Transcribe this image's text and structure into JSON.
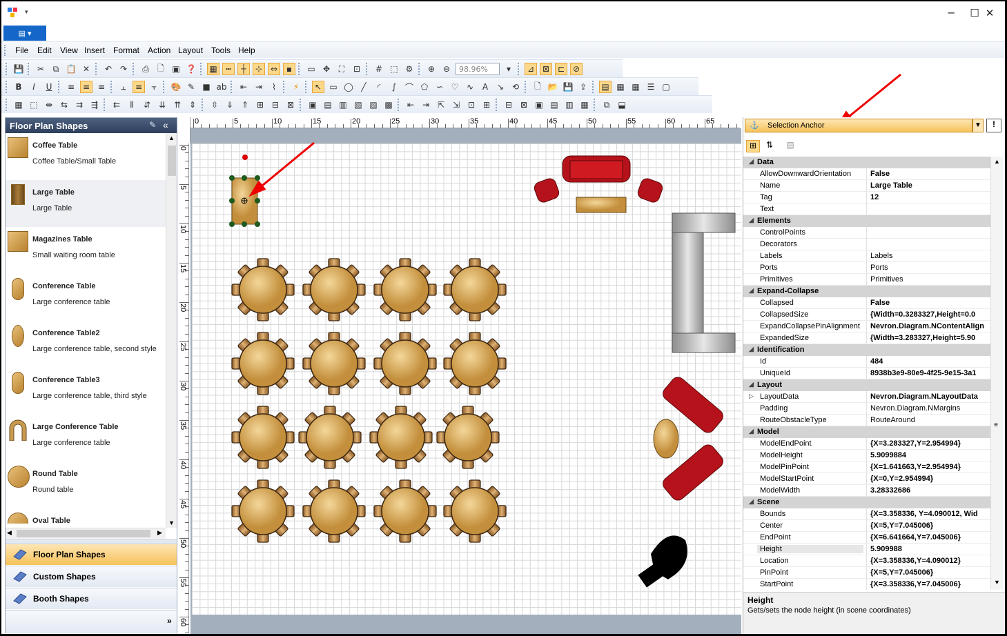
{
  "window": {
    "minimize": "─",
    "maximize": "☐",
    "close": "✕"
  },
  "app_menu": {
    "label": "▤ ▾"
  },
  "menubar": {
    "items": [
      "File",
      "Edit",
      "View",
      "Insert",
      "Format",
      "Action",
      "Layout",
      "Tools",
      "Help"
    ]
  },
  "toolbar": {
    "zoom": "98.96%"
  },
  "left_panel": {
    "title": "Floor Plan Shapes",
    "shapes": [
      {
        "name": "Coffee Table",
        "desc": "Coffee Table/Small Table"
      },
      {
        "name": "Large Table",
        "desc": "Large Table"
      },
      {
        "name": "Magazines Table",
        "desc": "Small waiting room table"
      },
      {
        "name": "Conference Table",
        "desc": "Large conference table"
      },
      {
        "name": "Conference Table2",
        "desc": "Large conference table, second style"
      },
      {
        "name": "Conference Table3",
        "desc": "Large conference table, third style"
      },
      {
        "name": "Large Conference Table",
        "desc": "Large conference table"
      },
      {
        "name": "Round Table",
        "desc": "Round table"
      },
      {
        "name": "Oval Table",
        "desc": ""
      }
    ],
    "nav": [
      "Floor Plan Shapes",
      "Custom Shapes",
      "Booth Shapes"
    ]
  },
  "ruler": {
    "h": [
      "0",
      "5",
      "10",
      "15",
      "20",
      "25",
      "30",
      "35",
      "40",
      "45",
      "50",
      "55",
      "60",
      "65"
    ],
    "v": [
      "0",
      "5",
      "10",
      "15",
      "20",
      "25",
      "30",
      "35",
      "40",
      "45",
      "50",
      "55",
      "60"
    ]
  },
  "property_grid": {
    "header": "Selection Anchor",
    "rows": [
      {
        "t": "cat",
        "n": "Data"
      },
      {
        "n": "AllowDownwardOrientation",
        "v": "False",
        "b": true
      },
      {
        "n": "Name",
        "v": "Large Table",
        "b": true
      },
      {
        "n": "Tag",
        "v": "12",
        "b": true
      },
      {
        "n": "Text",
        "v": ""
      },
      {
        "t": "cat",
        "n": "Elements"
      },
      {
        "n": "ControlPoints",
        "v": ""
      },
      {
        "n": "Decorators",
        "v": ""
      },
      {
        "n": "Labels",
        "v": "Labels"
      },
      {
        "n": "Ports",
        "v": "Ports"
      },
      {
        "n": "Primitives",
        "v": "Primitives"
      },
      {
        "t": "cat",
        "n": "Expand-Collapse"
      },
      {
        "n": "Collapsed",
        "v": "False",
        "b": true
      },
      {
        "n": "CollapsedSize",
        "v": "{Width=0.3283327,Height=0.0",
        "b": true
      },
      {
        "n": "ExpandCollapsePinAlignment",
        "v": "Nevron.Diagram.NContentAlign",
        "b": true
      },
      {
        "n": "ExpandedSize",
        "v": "{Width=3.283327,Height=5.90",
        "b": true
      },
      {
        "t": "cat",
        "n": "Identification"
      },
      {
        "n": "Id",
        "v": "484",
        "b": true
      },
      {
        "n": "UniqueId",
        "v": "8938b3e9-80e9-4f25-9e15-3a1",
        "b": true
      },
      {
        "t": "cat",
        "n": "Layout"
      },
      {
        "n": "LayoutData",
        "v": "Nevron.Diagram.NLayoutData",
        "b": true,
        "exp": true
      },
      {
        "n": "Padding",
        "v": "Nevron.Diagram.NMargins"
      },
      {
        "n": "RouteObstacleType",
        "v": "RouteAround"
      },
      {
        "t": "cat",
        "n": "Model"
      },
      {
        "n": "ModelEndPoint",
        "v": "{X=3.283327,Y=2.954994}",
        "b": true
      },
      {
        "n": "ModelHeight",
        "v": "5.9099884",
        "b": true
      },
      {
        "n": "ModelPinPoint",
        "v": "{X=1.641663,Y=2.954994}",
        "b": true
      },
      {
        "n": "ModelStartPoint",
        "v": "{X=0,Y=2.954994}",
        "b": true
      },
      {
        "n": "ModelWidth",
        "v": "3.28332686",
        "b": true
      },
      {
        "t": "cat",
        "n": "Scene"
      },
      {
        "n": "Bounds",
        "v": "{X=3.358336, Y=4.090012, Wid",
        "b": true
      },
      {
        "n": "Center",
        "v": "{X=5,Y=7.045006}",
        "b": true
      },
      {
        "n": "EndPoint",
        "v": "{X=6.641664,Y=7.045006}",
        "b": true
      },
      {
        "n": "Height",
        "v": "5.909988",
        "b": true,
        "sel": true
      },
      {
        "n": "Location",
        "v": "{X=3.358336,Y=4.090012}",
        "b": true
      },
      {
        "n": "PinPoint",
        "v": "{X=5,Y=7.045006}",
        "b": true
      },
      {
        "n": "StartPoint",
        "v": "{X=3.358336,Y=7.045006}",
        "b": true
      }
    ],
    "help_title": "Height",
    "help_desc": "Gets/sets the node height (in scene coordinates)"
  }
}
